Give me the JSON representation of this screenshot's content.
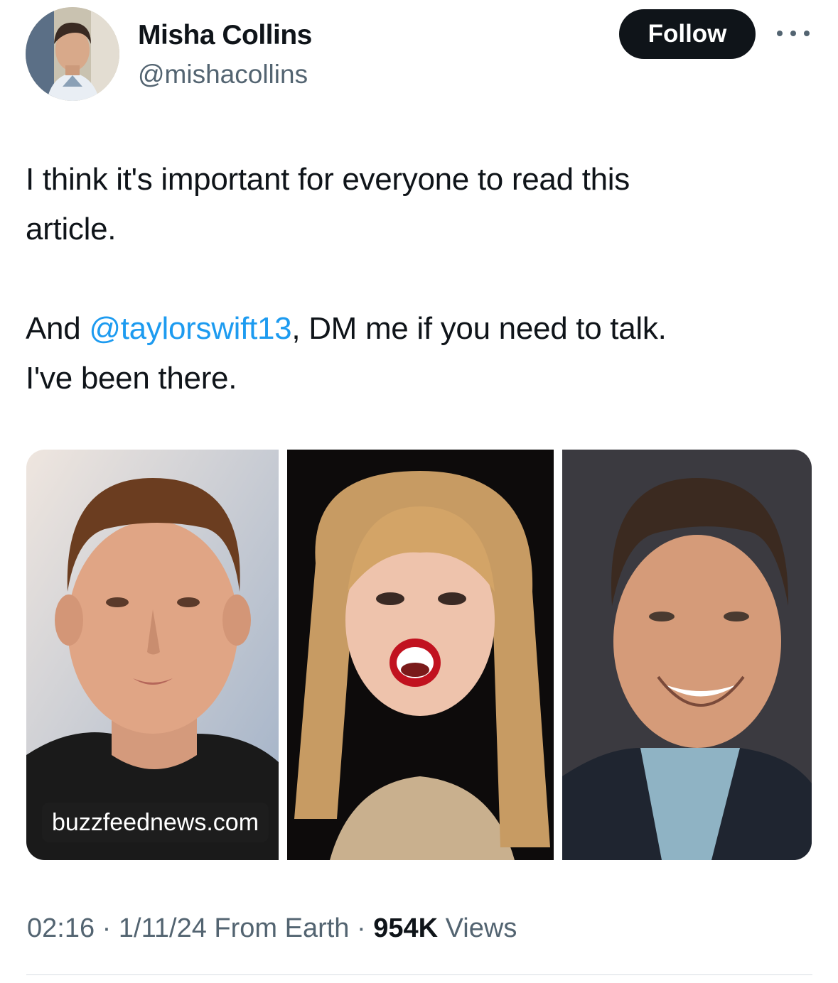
{
  "author": {
    "name": "Misha Collins",
    "handle": "@mishacollins",
    "avatar_icon": "profile-photo"
  },
  "actions": {
    "follow_label": "Follow",
    "more_icon": "ellipsis-icon"
  },
  "tweet": {
    "line1": "I think it's important for everyone to read this",
    "line2": "article.",
    "line3_prefix": "And ",
    "mention": "@taylorswift13",
    "line3_suffix": ", DM me if you need to talk.",
    "line4": "I've been there."
  },
  "media": {
    "source": "buzzfeednews.com",
    "images": [
      "man-portrait-photo",
      "woman-performer-photo",
      "smiling-man-photo"
    ]
  },
  "meta": {
    "time": "02:16",
    "sep1": " · ",
    "date": "1/11/24",
    "location": " From Earth",
    "sep2": " · ",
    "views_count": "954K",
    "views_label": " Views"
  },
  "colors": {
    "link": "#1d9bf0",
    "text": "#0f1419",
    "secondary": "#536471",
    "button": "#0f1419"
  }
}
